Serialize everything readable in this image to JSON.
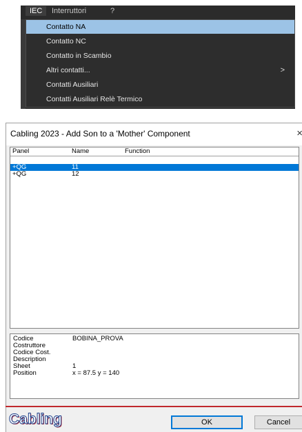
{
  "menu": {
    "bar": [
      "IEC",
      "Interruttori",
      "?"
    ],
    "items": [
      {
        "label": "Contatto NA",
        "highlighted": true
      },
      {
        "label": "Contatto NC"
      },
      {
        "label": "Contatto in Scambio"
      },
      {
        "label": "Altri contatti...",
        "submenu_arrow": ">"
      },
      {
        "label": "Contatti Ausiliari"
      },
      {
        "label": "Contatti Ausiliari Relè Termico"
      }
    ]
  },
  "dialog": {
    "title": "Cabling 2023 - Add Son to a 'Mother' Component",
    "close_glyph": "×",
    "columns": [
      "Panel",
      "Name",
      "Function"
    ],
    "rows": [
      {
        "panel": "+QG",
        "name": "11",
        "function": "",
        "selected": true
      },
      {
        "panel": "+QG",
        "name": "12",
        "function": ""
      }
    ],
    "info": [
      {
        "label": "Codice",
        "value": "BOBINA_PROVA"
      },
      {
        "label": "Costruttore",
        "value": ""
      },
      {
        "label": "Codice Cost.",
        "value": ""
      },
      {
        "label": "Description",
        "value": ""
      },
      {
        "label": "Sheet",
        "value": "1"
      },
      {
        "label": "Position",
        "value": "x = 87.5  y = 140"
      }
    ],
    "logo": "Cabling",
    "buttons": {
      "ok": "OK",
      "cancel": "Cancel"
    }
  }
}
